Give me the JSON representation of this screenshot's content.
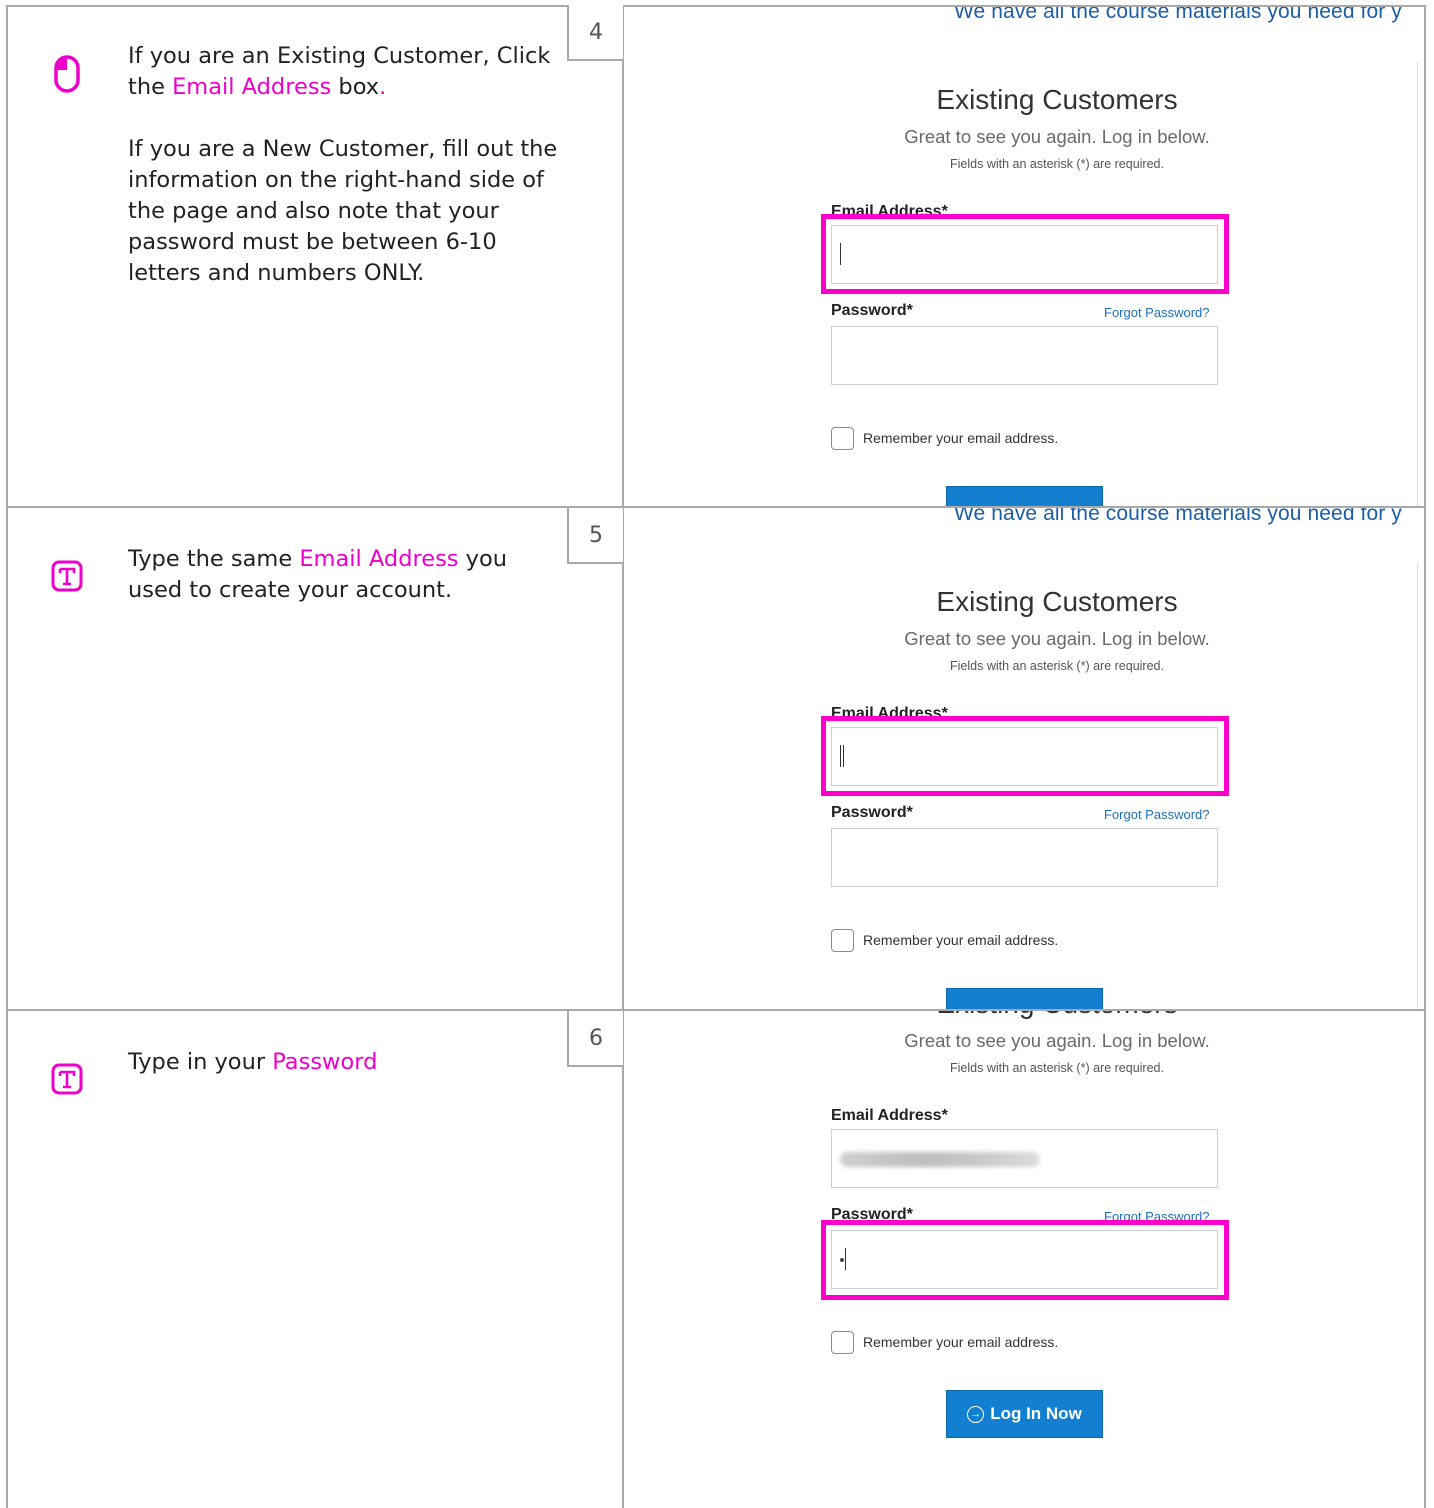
{
  "colors": {
    "highlight": "#ff00cc",
    "link": "#1a5ea8",
    "button": "#137fd1",
    "border": "#a9a9a9"
  },
  "steps": [
    {
      "number": "4",
      "icon": "mouse-icon",
      "para1": {
        "before": "If you are an Existing Customer, Click the ",
        "highlight": "Email Address",
        "after": " box",
        "end": "."
      },
      "para2": "If you are a New Customer, fill out the information on the right-hand side of the page and also note that your password must be between 6-10 letters and numbers ONLY."
    },
    {
      "number": "5",
      "icon": "text-input-icon",
      "para1": {
        "before": "Type the same ",
        "highlight": "Email Address",
        "after": " you used to create your account."
      }
    },
    {
      "number": "6",
      "icon": "text-input-icon",
      "para1": {
        "before": "Type in your ",
        "highlight": "Password"
      }
    }
  ],
  "login_page": {
    "banner": "We have all the course materials you need for y",
    "title": "Existing Customers",
    "subtitle": "Great to see you again. Log in below.",
    "required_note": "Fields with an asterisk (*) are required.",
    "email_label": "Email Address*",
    "password_label": "Password*",
    "forgot_link": "Forgot Password?",
    "remember_label": "Remember your email address.",
    "login_button": "Log In Now"
  }
}
